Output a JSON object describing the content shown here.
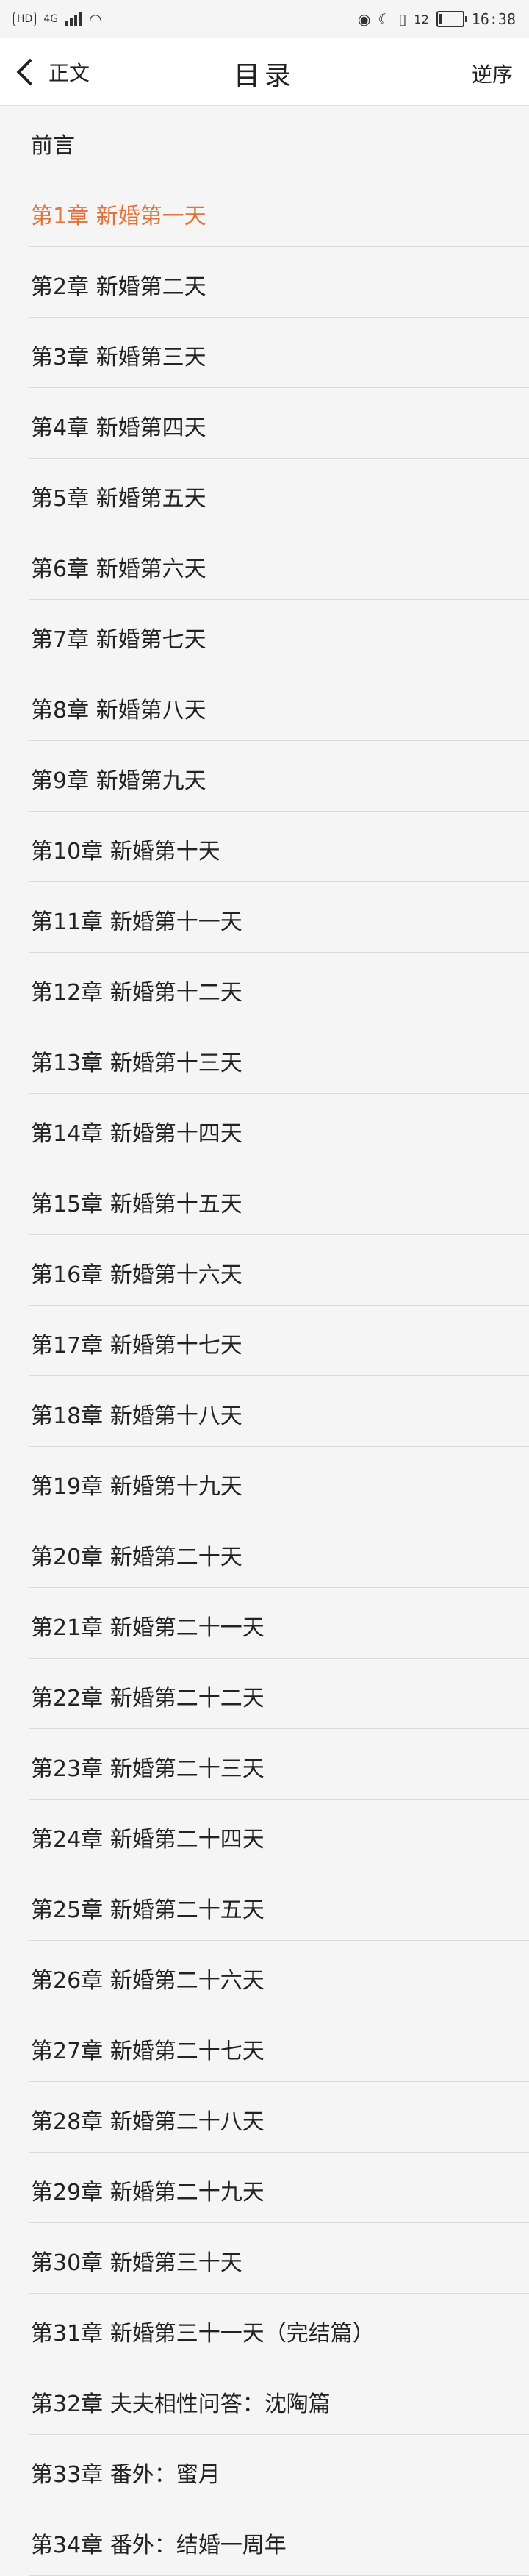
{
  "status_bar": {
    "network_chip": "HD",
    "network_type": "4G",
    "battery_text": "12",
    "battery_level": 0.12,
    "time": "16:38"
  },
  "header": {
    "back_label": "正文",
    "title": "目录",
    "reverse_label": "逆序"
  },
  "toc": {
    "active_index": 1,
    "items": [
      {
        "label": "前言"
      },
      {
        "label": "第1章 新婚第一天"
      },
      {
        "label": "第2章 新婚第二天"
      },
      {
        "label": "第3章 新婚第三天"
      },
      {
        "label": "第4章 新婚第四天"
      },
      {
        "label": "第5章 新婚第五天"
      },
      {
        "label": "第6章 新婚第六天"
      },
      {
        "label": "第7章 新婚第七天"
      },
      {
        "label": "第8章 新婚第八天"
      },
      {
        "label": "第9章 新婚第九天"
      },
      {
        "label": "第10章 新婚第十天"
      },
      {
        "label": "第11章 新婚第十一天"
      },
      {
        "label": "第12章 新婚第十二天"
      },
      {
        "label": "第13章 新婚第十三天"
      },
      {
        "label": "第14章 新婚第十四天"
      },
      {
        "label": "第15章 新婚第十五天"
      },
      {
        "label": "第16章 新婚第十六天"
      },
      {
        "label": "第17章 新婚第十七天"
      },
      {
        "label": "第18章 新婚第十八天"
      },
      {
        "label": "第19章 新婚第十九天"
      },
      {
        "label": "第20章 新婚第二十天"
      },
      {
        "label": "第21章 新婚第二十一天"
      },
      {
        "label": "第22章 新婚第二十二天"
      },
      {
        "label": "第23章 新婚第二十三天"
      },
      {
        "label": "第24章 新婚第二十四天"
      },
      {
        "label": "第25章 新婚第二十五天"
      },
      {
        "label": "第26章 新婚第二十六天"
      },
      {
        "label": "第27章 新婚第二十七天"
      },
      {
        "label": "第28章 新婚第二十八天"
      },
      {
        "label": "第29章 新婚第二十九天"
      },
      {
        "label": "第30章 新婚第三十天"
      },
      {
        "label": "第31章 新婚第三十一天（完结篇）"
      },
      {
        "label": "第32章 夫夫相性问答：沈陶篇"
      },
      {
        "label": "第33章 番外：蜜月"
      },
      {
        "label": "第34章 番外：结婚一周年"
      }
    ]
  },
  "colors": {
    "active": "#e2733a",
    "background": "#f5f5f5",
    "header_bg": "#ffffff"
  }
}
